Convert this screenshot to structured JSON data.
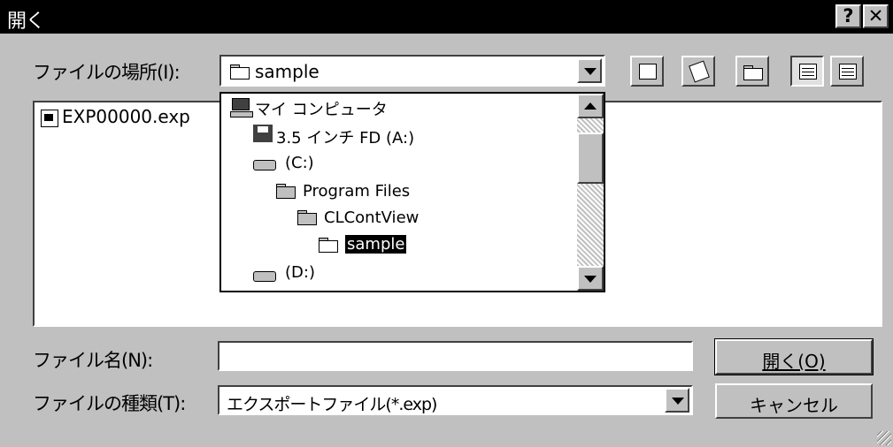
{
  "window": {
    "title": "開く",
    "help_label": "?",
    "close_label": "✕"
  },
  "location": {
    "label": "ファイルの場所(I):",
    "selected": "sample"
  },
  "toolbar": {
    "icons": [
      "up-one-level-icon",
      "desktop-icon",
      "new-folder-icon",
      "list-view-icon",
      "details-view-icon"
    ]
  },
  "file_list": {
    "items": [
      {
        "name": "EXP00000.exp",
        "icon": "exp-file-icon"
      }
    ]
  },
  "location_dropdown": {
    "items": [
      {
        "label": "マイ コンピュータ",
        "icon": "my-computer-icon"
      },
      {
        "label": "3.5 インチ FD (A:)",
        "icon": "floppy-drive-icon"
      },
      {
        "label": "(C:)",
        "icon": "hard-drive-icon"
      },
      {
        "label": "Program Files",
        "icon": "folder-icon"
      },
      {
        "label": "CLContView",
        "icon": "folder-icon"
      },
      {
        "label": "sample",
        "icon": "open-folder-icon",
        "selected": true
      },
      {
        "label": "(D:)",
        "icon": "cd-drive-icon"
      }
    ]
  },
  "filename": {
    "label": "ファイル名(N):",
    "value": ""
  },
  "filetype": {
    "label": "ファイルの種類(T):",
    "selected": "エクスポートファイル(*.exp)"
  },
  "buttons": {
    "open": "開く(O)",
    "cancel": "キャンセル"
  },
  "colors": {
    "face": "#c0c0c0",
    "titlebar": "#000000",
    "highlight": "#000000",
    "shadow": "#404040"
  }
}
